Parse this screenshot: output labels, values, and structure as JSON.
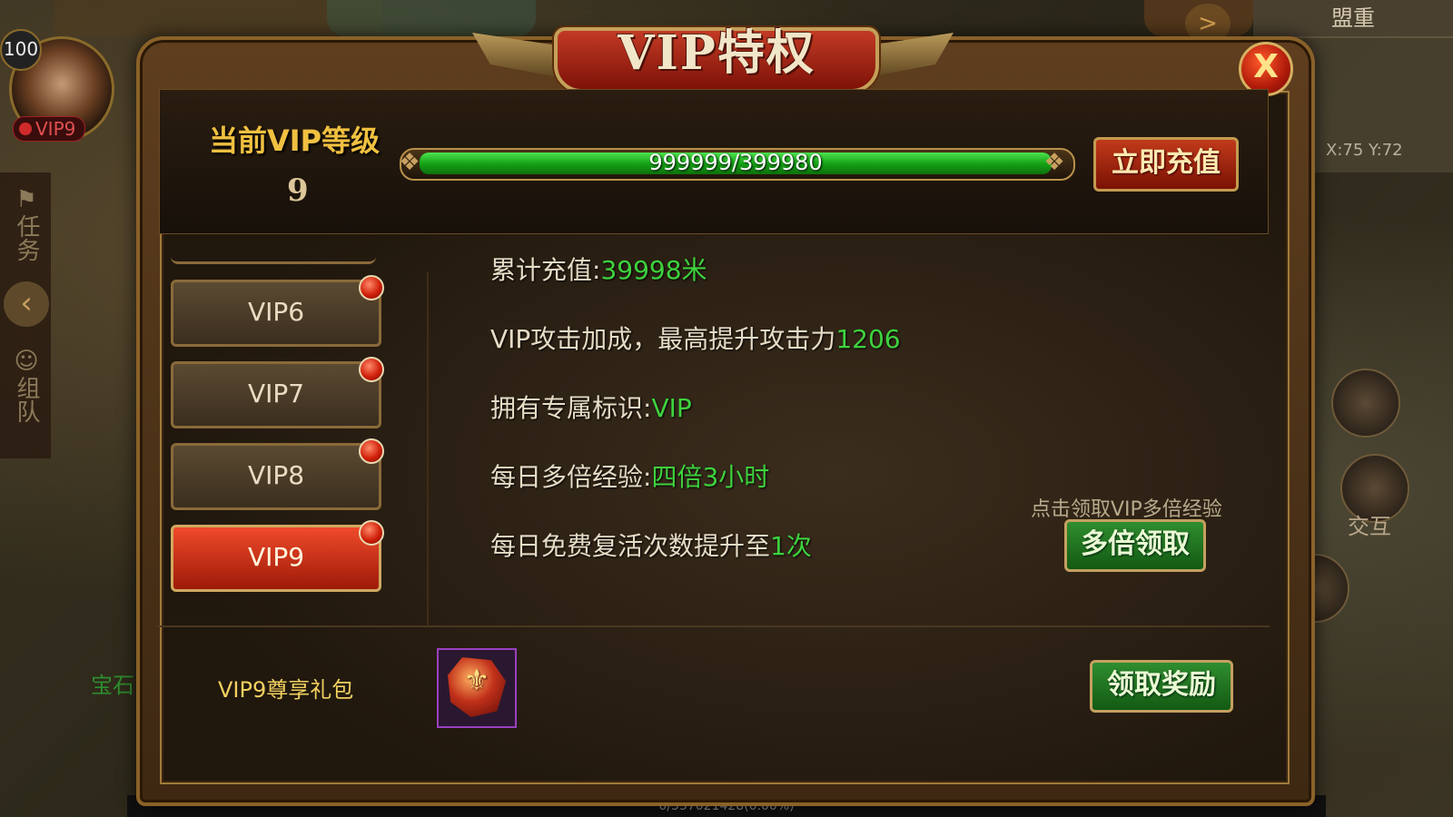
{
  "hud": {
    "player_level": "100",
    "vip_badge": "VIP9",
    "map_title": "盟重",
    "coords": "X:75  Y:72",
    "side_task": "任务",
    "side_team": "组队",
    "right_label_1": "交互",
    "left_text": "宝石",
    "exp_bar": "0/557021428(0.00%)"
  },
  "dialog": {
    "title": "VIP特权",
    "close_label": "X"
  },
  "status": {
    "current_label": "当前VIP等级",
    "current_level": "9",
    "progress_text": "999999/399980",
    "progress_fraction": 1.0,
    "recharge_button": "立即充值"
  },
  "tabs": [
    {
      "label": "VIP6",
      "active": false
    },
    {
      "label": "VIP7",
      "active": false
    },
    {
      "label": "VIP8",
      "active": false
    },
    {
      "label": "VIP9",
      "active": true
    }
  ],
  "privileges": {
    "p1_label": "累计充值:",
    "p1_value": "39998米",
    "p2_label": "VIP攻击加成，最高提升攻击力",
    "p2_value": "1206",
    "p3_label": "拥有专属标识:",
    "p3_value": "VIP",
    "p4_label": "每日多倍经验:",
    "p4_value": "四倍3小时",
    "p5_label": "每日免费复活次数提升至",
    "p5_value": "1次"
  },
  "exp_claim": {
    "hint": "点击领取VIP多倍经验",
    "button": "多倍领取"
  },
  "gift": {
    "label": "VIP9尊享礼包",
    "icon": "gift-box-icon",
    "button": "领取奖励"
  },
  "colors": {
    "highlight_green": "#3ed23e",
    "gold_text": "#f0c040",
    "active_tab_red": "#c0301a"
  }
}
